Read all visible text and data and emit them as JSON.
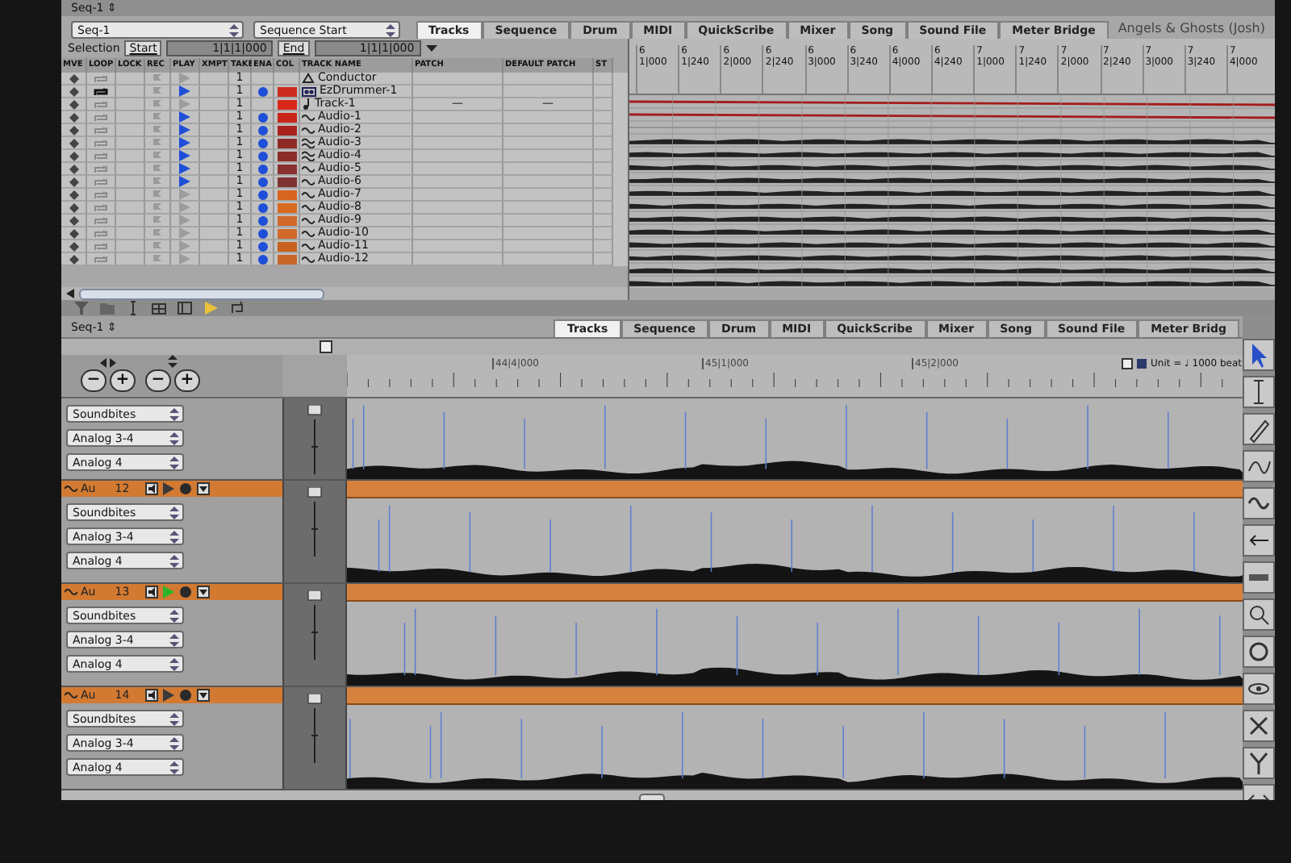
{
  "top_window": {
    "title_menu": "Seq-1 ⇕",
    "window_title": "Angels & Ghosts (Josh)",
    "sequence_select": "Seq-1",
    "start_select": "Sequence Start",
    "selection_label": "Selection",
    "start_button": "Start",
    "start_value": "1|1|1|000",
    "end_button": "End",
    "end_value": "1|1|1|000",
    "tabs": [
      {
        "label": "Tracks",
        "selected": true
      },
      {
        "label": "Sequence",
        "selected": false
      },
      {
        "label": "Drum",
        "selected": false
      },
      {
        "label": "MIDI",
        "selected": false
      },
      {
        "label": "QuickScribe",
        "selected": false
      },
      {
        "label": "Mixer",
        "selected": false
      },
      {
        "label": "Song",
        "selected": false
      },
      {
        "label": "Sound File",
        "selected": false
      },
      {
        "label": "Meter Bridge",
        "selected": false
      }
    ],
    "columns": [
      "MVE",
      "LOOP",
      "LOCK",
      "REC",
      "PLAY",
      "XMPT",
      "TAKE",
      "ENA",
      "COL",
      "TRACK NAME",
      "PATCH",
      "DEFAULT PATCH",
      "ST"
    ],
    "tracks": [
      {
        "kind": "conductor",
        "name": "Conductor",
        "take": "1",
        "loop": false,
        "play": false,
        "enabled": false
      },
      {
        "kind": "drummer",
        "name": "EzDrummer-1",
        "take": "1",
        "loop": true,
        "play": true,
        "enabled": true,
        "color": "#cc2a1e"
      },
      {
        "kind": "midi",
        "name": "Track-1",
        "take": "1",
        "loop": false,
        "play": false,
        "enabled": false,
        "color": "#d8281c",
        "patch": "—",
        "default_patch": "—"
      },
      {
        "kind": "audio",
        "name": "Audio-1",
        "take": "1",
        "loop": false,
        "play": true,
        "enabled": true,
        "color": "#c8241a"
      },
      {
        "kind": "audio",
        "name": "Audio-2",
        "take": "1",
        "loop": false,
        "play": true,
        "enabled": true,
        "color": "#a8221c"
      },
      {
        "kind": "stereo",
        "name": "Audio-3",
        "take": "1",
        "loop": false,
        "play": true,
        "enabled": true,
        "color": "#8e2a26"
      },
      {
        "kind": "stereo",
        "name": "Audio-4",
        "take": "1",
        "loop": false,
        "play": true,
        "enabled": true,
        "color": "#8a2c2a"
      },
      {
        "kind": "audio",
        "name": "Audio-5",
        "take": "1",
        "loop": false,
        "play": true,
        "enabled": true,
        "color": "#8a3030"
      },
      {
        "kind": "audio",
        "name": "Audio-6",
        "take": "1",
        "loop": false,
        "play": true,
        "enabled": true,
        "color": "#7e3232"
      },
      {
        "kind": "audio",
        "name": "Audio-7",
        "take": "1",
        "loop": false,
        "play": false,
        "enabled": true,
        "color": "#d8651e"
      },
      {
        "kind": "audio",
        "name": "Audio-8",
        "take": "1",
        "loop": false,
        "play": false,
        "enabled": true,
        "color": "#d86a20"
      },
      {
        "kind": "audio",
        "name": "Audio-9",
        "take": "1",
        "loop": false,
        "play": false,
        "enabled": true,
        "color": "#cf6a2a"
      },
      {
        "kind": "audio",
        "name": "Audio-10",
        "take": "1",
        "loop": false,
        "play": false,
        "enabled": true,
        "color": "#d06a2a"
      },
      {
        "kind": "audio",
        "name": "Audio-11",
        "take": "1",
        "loop": false,
        "play": false,
        "enabled": true,
        "color": "#c8621e"
      },
      {
        "kind": "audio",
        "name": "Audio-12",
        "take": "1",
        "loop": false,
        "play": false,
        "enabled": true,
        "color": "#c8662a"
      }
    ],
    "ruler": [
      {
        "bar": "6",
        "beat": "1|000"
      },
      {
        "bar": "6",
        "beat": "1|240"
      },
      {
        "bar": "6",
        "beat": "2|000"
      },
      {
        "bar": "6",
        "beat": "2|240"
      },
      {
        "bar": "6",
        "beat": "3|000"
      },
      {
        "bar": "6",
        "beat": "3|240"
      },
      {
        "bar": "6",
        "beat": "4|000"
      },
      {
        "bar": "6",
        "beat": "4|240"
      },
      {
        "bar": "7",
        "beat": "1|000"
      },
      {
        "bar": "7",
        "beat": "1|240"
      },
      {
        "bar": "7",
        "beat": "2|000"
      },
      {
        "bar": "7",
        "beat": "2|240"
      },
      {
        "bar": "7",
        "beat": "3|000"
      },
      {
        "bar": "7",
        "beat": "3|240"
      },
      {
        "bar": "7",
        "beat": "4|000"
      }
    ]
  },
  "bottom_window": {
    "title_menu": "Seq-1 ⇕",
    "tabs": [
      {
        "label": "Tracks",
        "selected": true
      },
      {
        "label": "Sequence",
        "selected": false
      },
      {
        "label": "Drum",
        "selected": false
      },
      {
        "label": "MIDI",
        "selected": false
      },
      {
        "label": "QuickScribe",
        "selected": false
      },
      {
        "label": "Mixer",
        "selected": false
      },
      {
        "label": "Song",
        "selected": false
      },
      {
        "label": "Sound File",
        "selected": false
      },
      {
        "label": "Meter Bridg",
        "selected": false
      }
    ],
    "zoom_buttons": [
      "−",
      "+",
      "−",
      "+"
    ],
    "unit": "Unit = ♩ 1000 beat",
    "ruler": [
      "44|4|000",
      "45|1|000",
      "45|2|000"
    ],
    "tracks": [
      {
        "kind": "partial",
        "inputs": [
          "Soundbites",
          "Analog 3-4",
          "Analog 4"
        ]
      },
      {
        "kind": "full",
        "name": "Au",
        "number": "12",
        "playing": false,
        "inputs": [
          "Soundbites",
          "Analog 3-4",
          "Analog 4"
        ]
      },
      {
        "kind": "full",
        "name": "Au",
        "number": "13",
        "playing": true,
        "inputs": [
          "Soundbites",
          "Analog 3-4",
          "Analog 4"
        ]
      },
      {
        "kind": "full",
        "name": "Au",
        "number": "14",
        "playing": false,
        "inputs": [
          "Soundbites",
          "Analog 3-4",
          "Analog 4"
        ]
      }
    ]
  }
}
